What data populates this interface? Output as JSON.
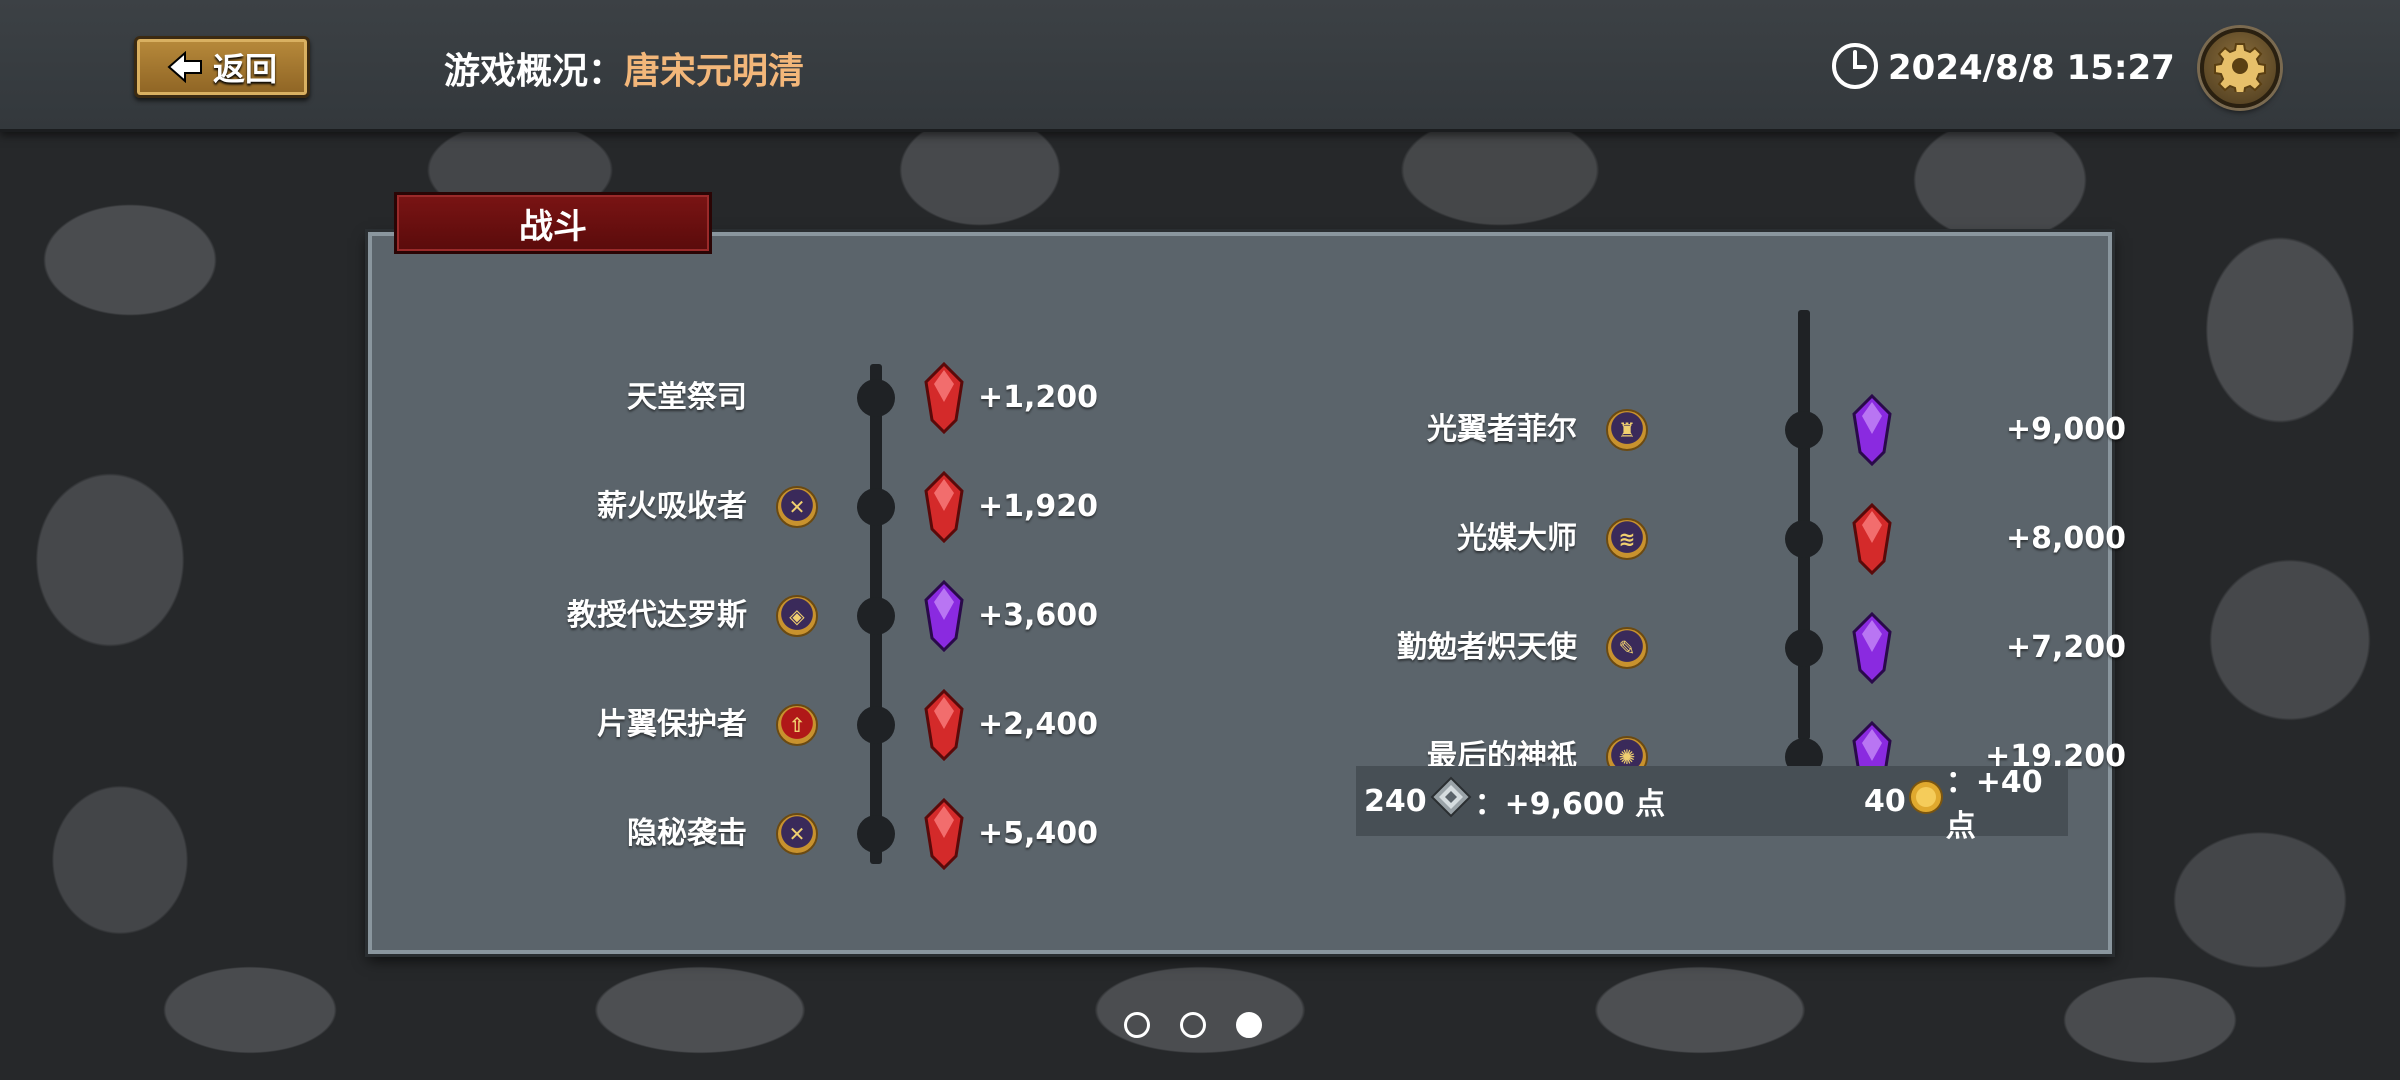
{
  "header": {
    "back_label": "返回",
    "title_label": "游戏概况：",
    "title_value": "唐宋元明清",
    "datetime": "2024/8/8 15:27",
    "icons": {
      "back": "left-arrow-icon",
      "clock": "clock-icon",
      "settings": "gear-icon"
    }
  },
  "panel": {
    "tab_label": "战斗",
    "left_column": [
      {
        "name": "天堂祭司",
        "badge_icon": "",
        "gem": "red",
        "points": "+1,200"
      },
      {
        "name": "薪火吸收者",
        "badge_icon": "crossed-swords-icon",
        "gem": "red",
        "points": "+1,920"
      },
      {
        "name": "教授代达罗斯",
        "badge_icon": "rune-icon",
        "gem": "purple",
        "points": "+3,600"
      },
      {
        "name": "片翼保护者",
        "badge_icon": "up-arrow-icon",
        "gem": "red",
        "points": "+2,400"
      },
      {
        "name": "隐秘袭击",
        "badge_icon": "crossed-swords-icon",
        "gem": "red",
        "points": "+5,400"
      }
    ],
    "right_column": [
      {
        "name": "光翼者菲尔",
        "badge_icon": "bell-icon",
        "gem": "purple",
        "points": "+9,000"
      },
      {
        "name": "光媒大师",
        "badge_icon": "wind-icon",
        "gem": "red",
        "points": "+8,000"
      },
      {
        "name": "勤勉者炽天使",
        "badge_icon": "scroll-icon",
        "gem": "purple",
        "points": "+7,200"
      },
      {
        "name": "最后的神祇",
        "badge_icon": "octopus-icon",
        "gem": "purple",
        "points": "+19,200"
      }
    ],
    "summary": {
      "left_count": "240",
      "left_icon": "diamond-shard-icon",
      "left_text": "：+9,600 点",
      "right_count": "40",
      "right_icon": "gold-coin-icon",
      "right_text": "：+40 点"
    }
  },
  "pager": {
    "total": 3,
    "active_index": 2
  },
  "colors": {
    "accent_orange": "#f3b77a",
    "tab_red": "#7a1414",
    "gem_red": "#d42a2a",
    "gem_purple": "#8a2ae0",
    "panel_bg": "#5b646b"
  }
}
